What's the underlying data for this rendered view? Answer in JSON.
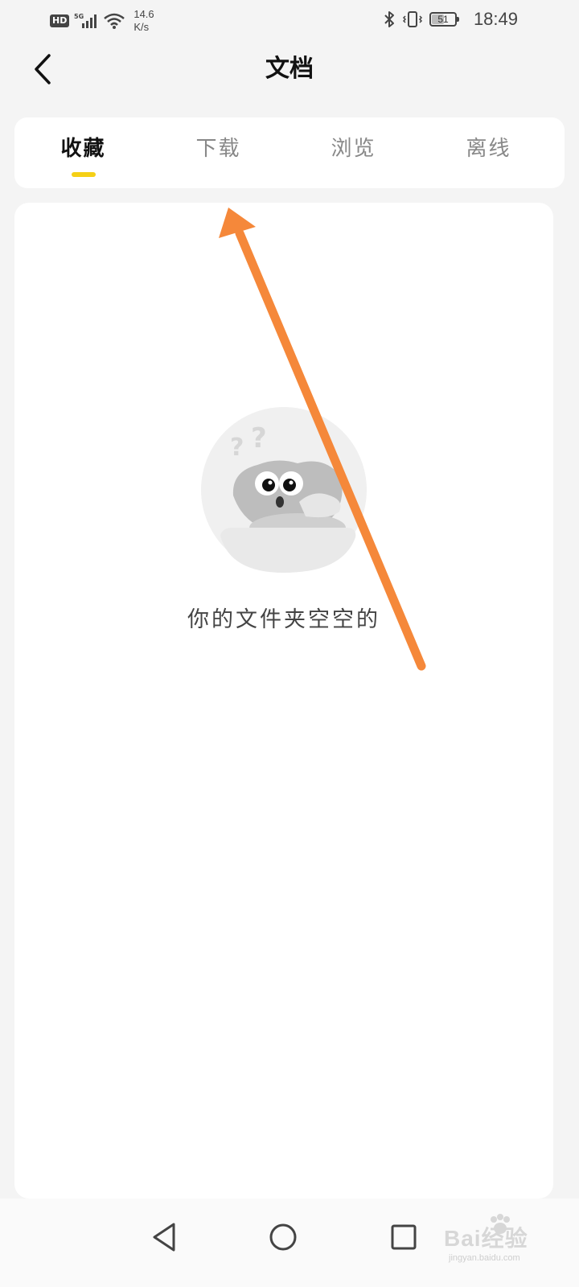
{
  "status_bar": {
    "hd_badge": "HD",
    "network": "5G",
    "speed_value": "14.6",
    "speed_unit": "K/s",
    "battery_level": "51",
    "time": "18:49"
  },
  "header": {
    "title": "文档"
  },
  "tabs": [
    {
      "label": "收藏",
      "active": true
    },
    {
      "label": "下载",
      "active": false
    },
    {
      "label": "浏览",
      "active": false
    },
    {
      "label": "离线",
      "active": false
    }
  ],
  "main": {
    "empty_message": "你的文件夹空空的"
  },
  "watermark": {
    "main": "Bai经验",
    "sub": "jingyan.baidu.com"
  },
  "colors": {
    "accent": "#f5d016",
    "annotation": "#f5883a",
    "background": "#f4f4f4",
    "card": "#ffffff"
  }
}
